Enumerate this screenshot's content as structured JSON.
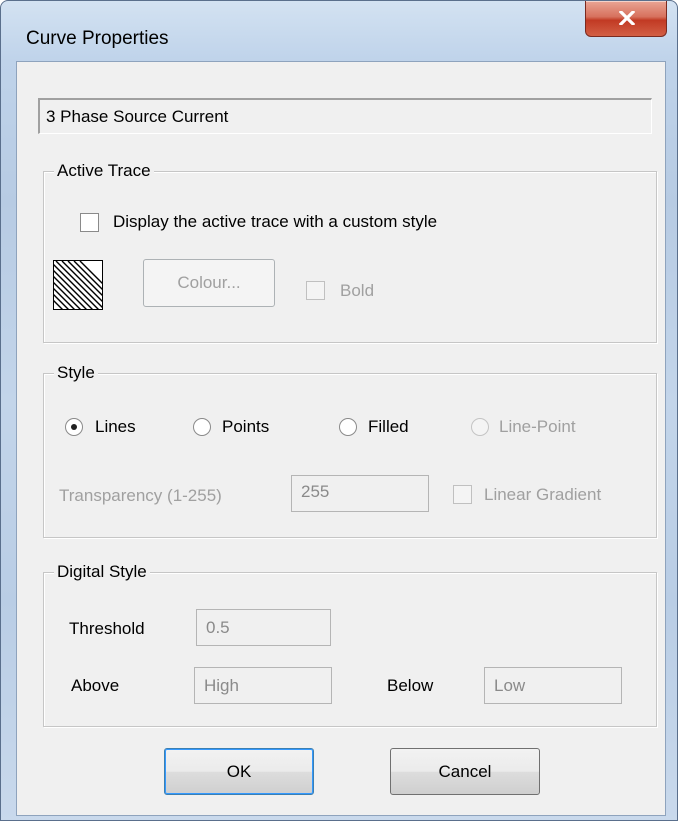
{
  "window": {
    "title": "Curve Properties"
  },
  "curve_name": "3 Phase Source Current",
  "active_trace": {
    "legend": "Active Trace",
    "custom_style_label": "Display the active trace with a custom style",
    "custom_style_checked": false,
    "colour_button": "Colour...",
    "bold_label": "Bold",
    "bold_checked": false
  },
  "style": {
    "legend": "Style",
    "options": [
      "Lines",
      "Points",
      "Filled",
      "Line-Point"
    ],
    "selected": "Lines",
    "transparency_label": "Transparency (1-255)",
    "transparency_value": "255",
    "linear_gradient_label": "Linear Gradient",
    "linear_gradient_checked": false
  },
  "digital_style": {
    "legend": "Digital Style",
    "threshold_label": "Threshold",
    "threshold_value": "0.5",
    "above_label": "Above",
    "above_value": "High",
    "below_label": "Below",
    "below_value": "Low"
  },
  "buttons": {
    "ok": "OK",
    "cancel": "Cancel"
  },
  "colors": {
    "close_button": "#c8442c",
    "title_bar": "#bfd3ea",
    "dialog_face": "#f0f0f0"
  },
  "icons": {
    "close": "close-icon",
    "hatch_swatch": "hatch-pattern-swatch"
  }
}
